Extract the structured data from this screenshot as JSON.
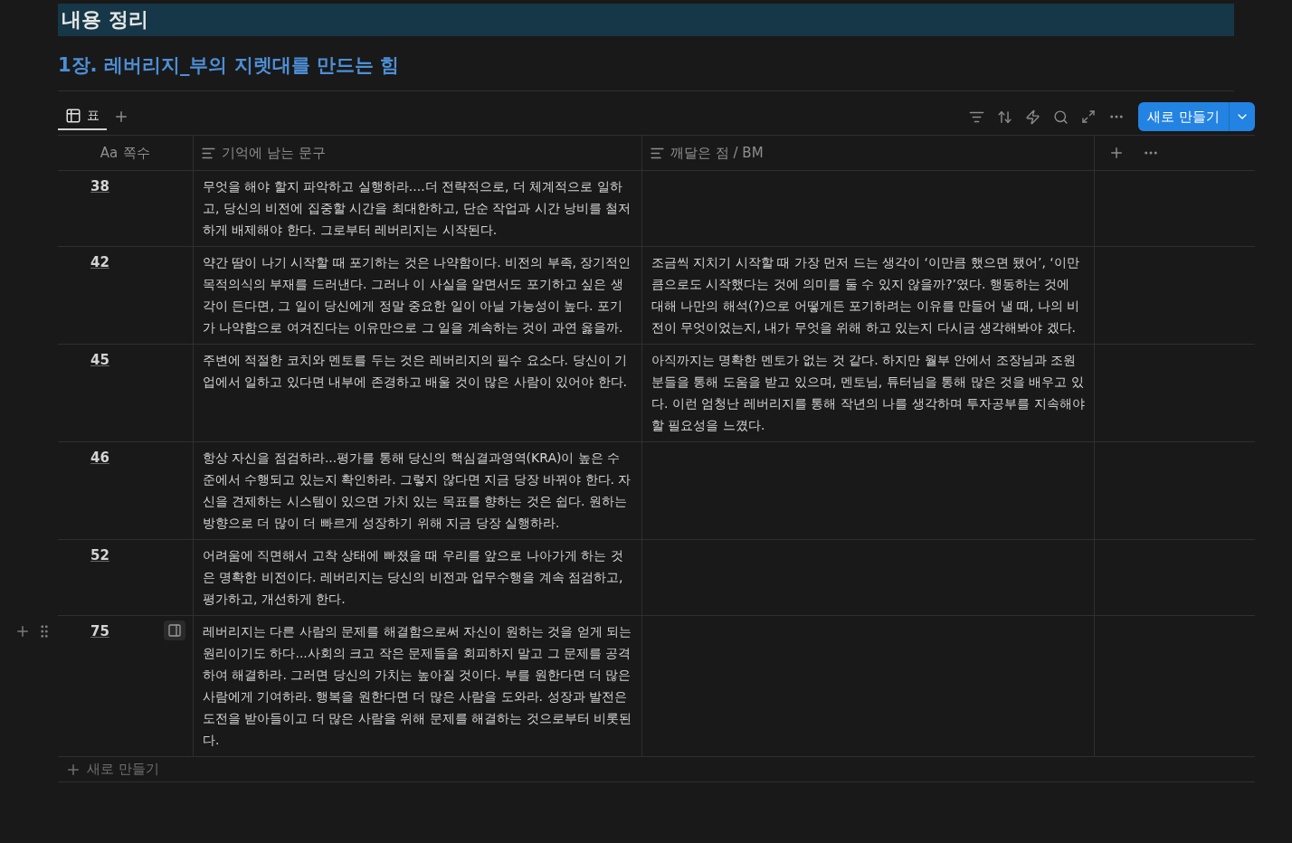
{
  "heading": "내용 정리",
  "subheading": "1장. 레버리지_부의 지렛대를 만드는 힘",
  "view_tab": {
    "label": "표",
    "selected": true
  },
  "new_button": {
    "label": "새로 만들기"
  },
  "columns": [
    {
      "kind": "title",
      "label": "쪽수",
      "icon": "Aa"
    },
    {
      "kind": "text",
      "label": "기억에 남는 문구"
    },
    {
      "kind": "text",
      "label": "깨달은 점 / BM"
    }
  ],
  "rows": [
    {
      "page": "38",
      "hovered": false,
      "quote": "무엇을 해야 할지 파악하고 실행하라....더 전략적으로, 더 체계적으로 일하고, 당신의 비전에 집중할 시간을 최대한하고, 단순 작업과 시간 낭비를 철저하게 배제해야 한다. 그로부터 레버리지는 시작된다.",
      "insight": ""
    },
    {
      "page": "42",
      "hovered": false,
      "quote": "약간 땀이 나기 시작할 때 포기하는 것은 나약함이다. 비전의 부족, 장기적인 목적의식의 부재를 드러낸다. 그러나 이 사실을 알면서도 포기하고 싶은 생각이 든다면, 그 일이 당신에게 정말 중요한 일이 아닐 가능성이 높다. 포기가 나약함으로 여겨진다는 이유만으로 그 일을 계속하는 것이 과연 옳을까.",
      "insight": "조금씩 지치기 시작할 때 가장 먼저 드는 생각이 ‘이만큼 했으면 됐어’, ‘이만큼으로도 시작했다는 것에 의미를 둘 수 있지 않을까?’였다. 행동하는 것에 대해 나만의 해석(?)으로 어떻게든 포기하려는 이유를 만들어 낼 때, 나의 비전이 무엇이었는지, 내가 무엇을 위해 하고 있는지 다시금 생각해봐야 겠다."
    },
    {
      "page": "45",
      "hovered": false,
      "quote": "주변에 적절한 코치와 멘토를 두는 것은 레버리지의 필수 요소다. 당신이 기업에서 일하고 있다면 내부에 존경하고 배울 것이 많은 사람이 있어야 한다.",
      "insight": "아직까지는 명확한 멘토가 없는 것 같다. 하지만 월부 안에서 조장님과 조원분들을 통해 도움을 받고 있으며, 멘토님, 튜터님을 통해 많은 것을 배우고 있다. 이런 엄청난 레버리지를 통해 작년의 나를 생각하며 투자공부를 지속해야 할 필요성을 느꼈다."
    },
    {
      "page": "46",
      "hovered": false,
      "quote": "항상 자신을 점검하라...평가를 통해 당신의 핵심결과영역(KRA)이 높은 수준에서 수행되고 있는지 확인하라. 그렇지 않다면 지금 당장 바꿔야 한다. 자신을 견제하는 시스템이 있으면 가치 있는 목표를 향하는 것은 쉽다. 원하는 방향으로 더 많이 더 빠르게 성장하기 위해 지금 당장 실행하라.",
      "insight": ""
    },
    {
      "page": "52",
      "hovered": false,
      "quote": "어려움에 직면해서 고착 상태에 빠졌을 때 우리를 앞으로 나아가게 하는 것은 명확한 비전이다. 레버리지는 당신의 비전과 업무수행을 계속 점검하고, 평가하고, 개선하게 한다.",
      "insight": ""
    },
    {
      "page": "75",
      "hovered": true,
      "quote": "레버리지는 다른 사람의 문제를 해결함으로써 자신이 원하는 것을 얻게 되는 원리이기도 하다...사회의 크고 작은 문제들을 회피하지 말고 그 문제를 공격하여 해결하라. 그러면 당신의 가치는 높아질 것이다. 부를 원한다면 더 많은 사람에게 기여하라. 행복을 원한다면 더 많은 사람을 도와라. 성장과 발전은 도전을 받아들이고 더 많은 사람을 위해 문제를 해결하는 것으로부터 비롯된다.",
      "insight": ""
    }
  ],
  "add_row": {
    "label": "새로 만들기"
  }
}
